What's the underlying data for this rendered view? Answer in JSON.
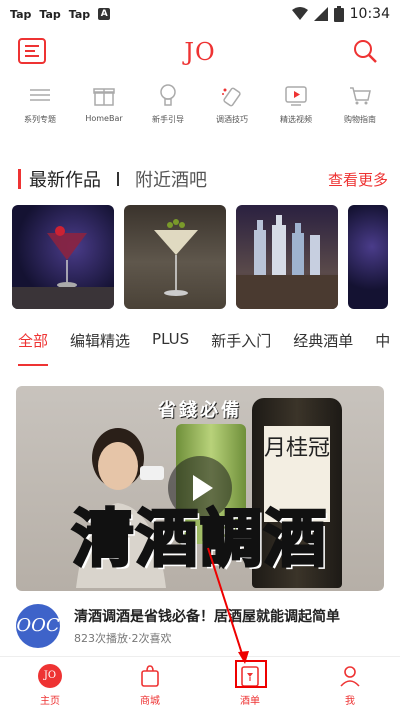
{
  "status": {
    "notifications": [
      "Tap",
      "Tap",
      "Tap"
    ],
    "app_badge": "A",
    "time": "10:34"
  },
  "header": {
    "logo": "JO"
  },
  "categories": [
    {
      "label": "系列专题",
      "icon": "list-icon"
    },
    {
      "label": "HomeBar",
      "icon": "gift-box-icon"
    },
    {
      "label": "新手引导",
      "icon": "lightbulb-icon"
    },
    {
      "label": "调酒技巧",
      "icon": "shaker-icon"
    },
    {
      "label": "精选视频",
      "icon": "video-play-icon"
    },
    {
      "label": "购物指南",
      "icon": "cart-icon"
    }
  ],
  "section": {
    "title": "最新作品",
    "alt_title": "附近酒吧",
    "more": "查看更多"
  },
  "photos": [
    {
      "alt": "cocktail-martini-glass"
    },
    {
      "alt": "martini-with-olives"
    },
    {
      "alt": "liquor-bottles-shelf"
    }
  ],
  "tabs": [
    "全部",
    "编辑精选",
    "PLUS",
    "新手入门",
    "经典酒单",
    "中"
  ],
  "video": {
    "banner": "省錢必備",
    "overlay": "清酒調酒",
    "label_text": "月桂冠",
    "title": "清酒调酒是省钱必备！居酒屋就能调起简单",
    "meta": "823次播放·2次喜欢",
    "channel_badge": "OOC"
  },
  "nav": [
    {
      "label": "主页",
      "icon": "home-icon"
    },
    {
      "label": "商城",
      "icon": "shopping-bag-icon"
    },
    {
      "label": "酒单",
      "icon": "drink-menu-icon"
    },
    {
      "label": "我",
      "icon": "user-icon"
    }
  ],
  "colors": {
    "accent": "#e33333"
  }
}
